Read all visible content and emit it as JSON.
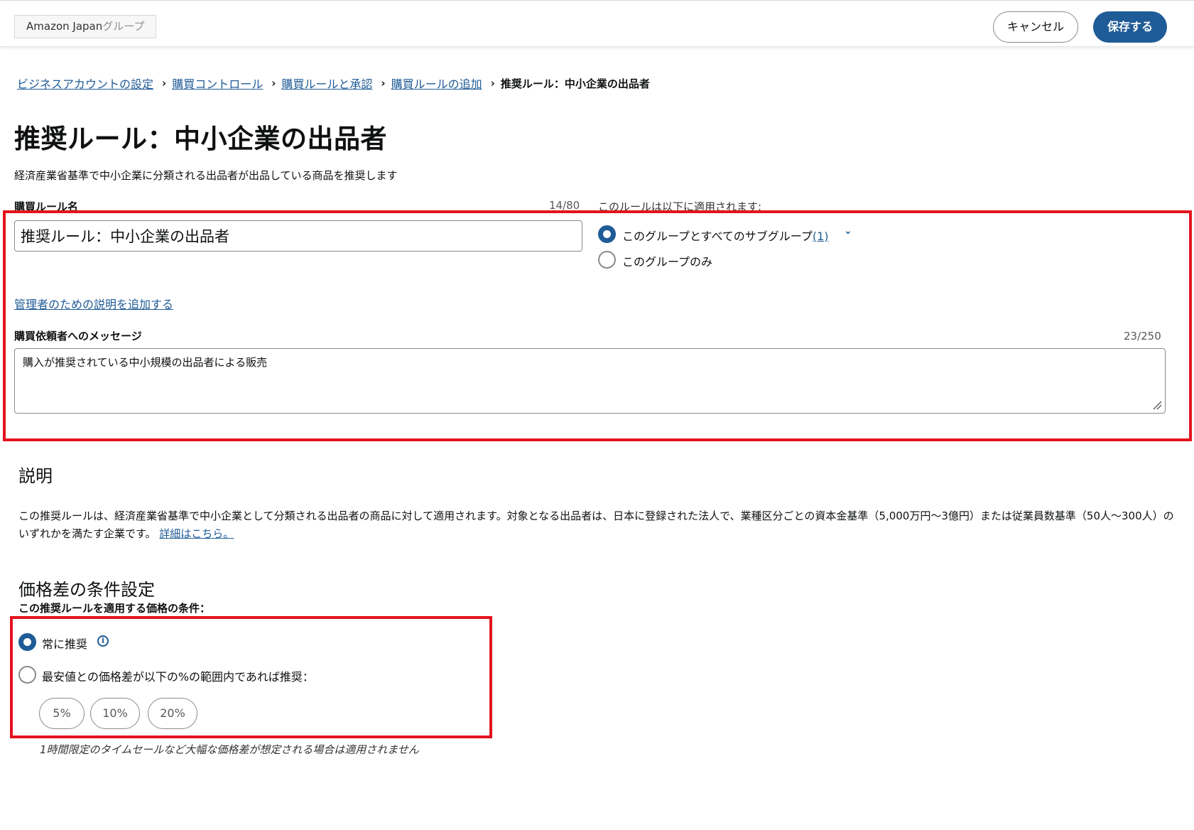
{
  "topbar": {
    "group_name": "Amazon Japan",
    "group_suffix": "グループ",
    "cancel_label": "キャンセル",
    "save_label": "保存する"
  },
  "breadcrumb": {
    "items": [
      "ビジネスアカウントの設定",
      "購買コントロール",
      "購買ルールと承認",
      "購買ルールの追加"
    ],
    "current": "推奨ルール：中小企業の出品者"
  },
  "page": {
    "title": "推奨ルール：中小企業の出品者",
    "subtitle": "経済産業省基準で中小企業に分類される出品者が出品している商品を推奨します"
  },
  "rule_form": {
    "name_label": "購買ルール名",
    "name_value": "推奨ルール：中小企業の出品者",
    "name_counter": "14/80",
    "applies_label": "このルールは以下に適用されます:",
    "scope_options": [
      {
        "label": "このグループとすべてのサブグループ",
        "count": "(1)",
        "selected": true
      },
      {
        "label": "このグループのみ",
        "selected": false
      }
    ],
    "admin_link": "管理者のための説明を追加する",
    "message_label": "購買依頼者へのメッセージ",
    "message_counter": "23/250",
    "message_value": "購入が推奨されている中小規模の出品者による販売"
  },
  "description": {
    "heading": "説明",
    "text": "この推奨ルールは、経済産業省基準で中小企業として分類される出品者の商品に対して適用されます。対象となる出品者は、日本に登録された法人で、業種区分ごとの資本金基準（5,000万円～3億円）または従業員数基準（50人～300人）のいずれかを満たす企業です。",
    "link": "詳細はこちら。"
  },
  "price_condition": {
    "heading": "価格差の条件設定",
    "label": "この推奨ルールを適用する価格の条件：",
    "options": [
      {
        "label": "常に推奨",
        "selected": true
      },
      {
        "label": "最安値との価格差が以下の%の範囲内であれば推奨：",
        "selected": false
      }
    ],
    "chips": [
      "5%",
      "10%",
      "20%"
    ],
    "footnote": "1時間限定のタイムセールなど大幅な価格差が想定される場合は適用されません"
  },
  "colors": {
    "accent": "#1f5b97",
    "highlight": "#e3131e"
  },
  "icons": {
    "info": "info-icon",
    "chevron": "chevron-down-icon",
    "breadcrumb_separator": "chevron-right-icon"
  }
}
